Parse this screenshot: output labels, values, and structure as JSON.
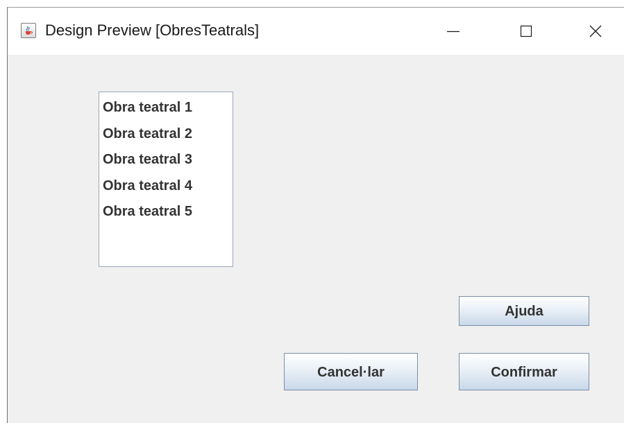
{
  "window": {
    "title": "Design Preview [ObresTeatrals]",
    "icon": "java-cup-icon"
  },
  "list": {
    "items": [
      "Obra teatral 1",
      "Obra teatral 2",
      "Obra teatral 3",
      "Obra teatral 4",
      "Obra teatral 5"
    ]
  },
  "buttons": {
    "help_label": "Ajuda",
    "cancel_label": "Cancel·lar",
    "confirm_label": "Confirmar"
  },
  "colors": {
    "window_background": "#f0f0f0",
    "titlebar_background": "#ffffff",
    "text": "#333333",
    "button_border": "#7a8ea6"
  }
}
